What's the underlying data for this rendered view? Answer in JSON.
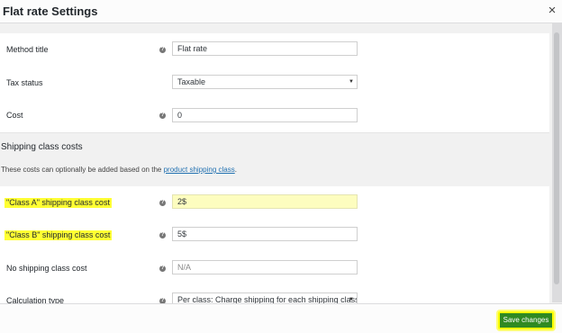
{
  "modal": {
    "title": "Flat rate Settings",
    "close_symbol": "×"
  },
  "fields": {
    "method_title": {
      "label": "Method title",
      "value": "Flat rate"
    },
    "tax_status": {
      "label": "Tax status",
      "value": "Taxable"
    },
    "cost": {
      "label": "Cost",
      "value": "0"
    }
  },
  "shipping_class_costs": {
    "heading": "Shipping class costs",
    "description_prefix": "These costs can optionally be added based on the ",
    "description_link": "product shipping class",
    "description_suffix": ".",
    "class_a": {
      "label": "\"Class A\" shipping class cost",
      "value": "2$"
    },
    "class_b": {
      "label": "\"Class B\" shipping class cost",
      "value": "5$"
    },
    "no_class": {
      "label": "No shipping class cost",
      "placeholder": "N/A"
    },
    "calculation_type": {
      "label": "Calculation type",
      "value": "Per class: Charge shipping for each shipping class"
    }
  },
  "footer": {
    "save_label": "Save changes"
  },
  "colors": {
    "highlight": "#ffff33",
    "save_button": "#2f8a22",
    "link": "#2271b1"
  },
  "icons": {
    "help": "help-icon",
    "close": "close-icon",
    "select_caret": "chevron-down-icon"
  }
}
